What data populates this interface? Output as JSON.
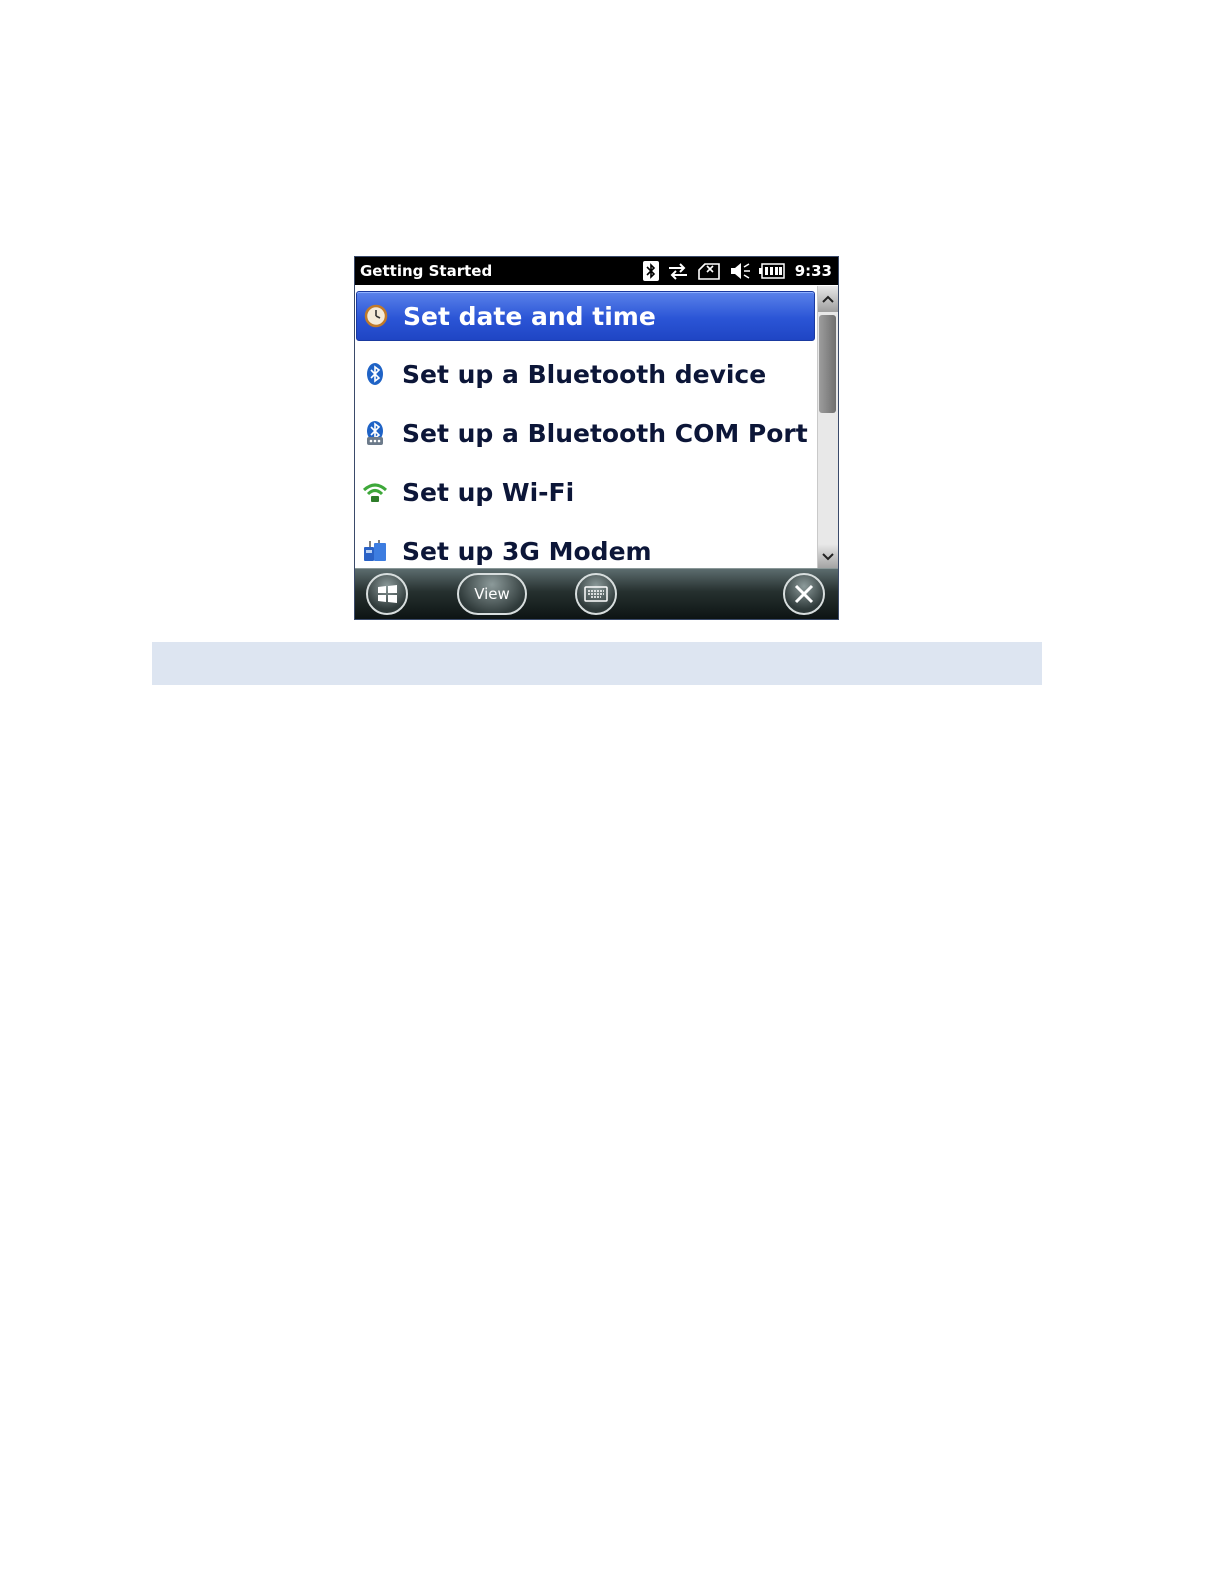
{
  "window": {
    "title": "Getting Started",
    "time": "9:33"
  },
  "status_icons": [
    "bluetooth-icon",
    "sync-arrows-icon",
    "no-signal-icon",
    "mute-speaker-icon",
    "battery-icon"
  ],
  "menu": {
    "items": [
      {
        "label": "Set date and time",
        "icon": "clock-icon",
        "selected": true
      },
      {
        "label": "Set up a Bluetooth device",
        "icon": "bluetooth-icon"
      },
      {
        "label": "Set up a Bluetooth COM Port",
        "icon": "bluetooth-com-icon"
      },
      {
        "label": "Set up Wi-Fi",
        "icon": "wifi-icon"
      },
      {
        "label": "Set up 3G Modem",
        "icon": "modem-icon"
      }
    ]
  },
  "taskbar": {
    "view_label": "View",
    "buttons": [
      "windows-start-icon",
      "keyboard-icon",
      "close-icon"
    ]
  },
  "colors": {
    "selection": "#2b55d6",
    "item_text": "#0c1638",
    "caption_band": "#dde5f1"
  }
}
